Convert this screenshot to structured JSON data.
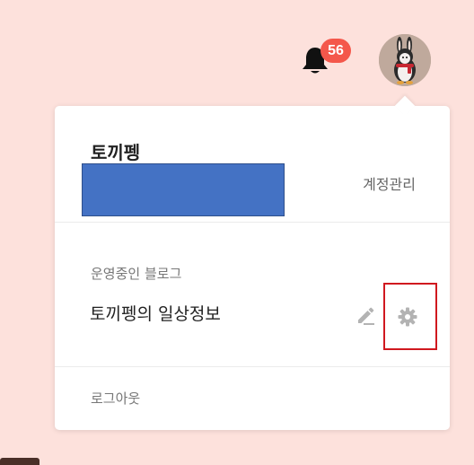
{
  "header": {
    "notifications": {
      "count": "56",
      "icon": "bell-icon",
      "badge_color": "#f4574b"
    },
    "avatar": {
      "icon": "rabbit-avatar"
    }
  },
  "menu": {
    "username": "토끼펭",
    "account_link": "계정관리",
    "blogs_heading": "운영중인 블로그",
    "blogs": [
      {
        "name": "토끼펭의 일상정보",
        "actions": [
          "pencil-icon",
          "gear-icon"
        ]
      }
    ],
    "logout": "로그아웃"
  },
  "theme": {
    "page_background": "#fde1dc",
    "redaction_color": "#4472c4",
    "highlight_border": "#d0181f"
  }
}
